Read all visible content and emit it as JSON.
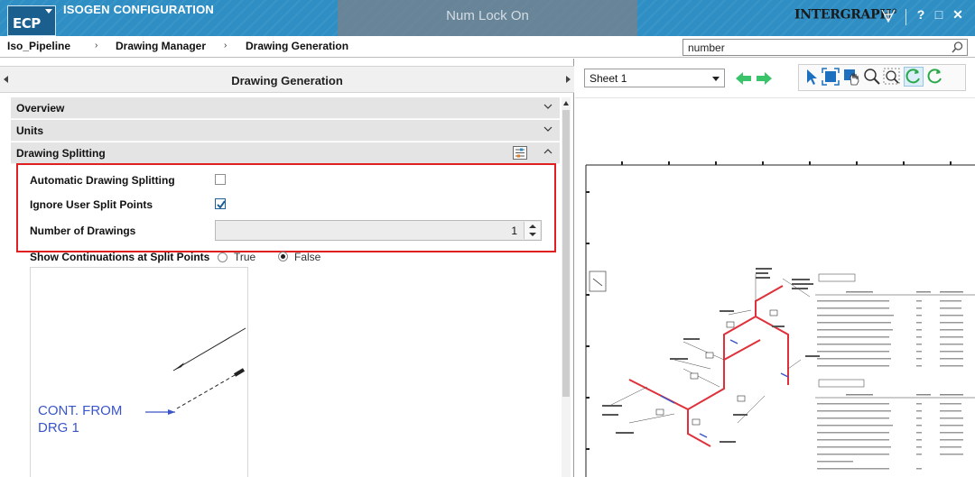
{
  "app": {
    "logo": "ECP",
    "title": "ISOGEN CONFIGURATION",
    "toast": "Num Lock On",
    "brand": "INTERGRAPH",
    "brand_mark": "®",
    "window_controls": {
      "help": "?",
      "restore": "□",
      "close": "✕"
    }
  },
  "breadcrumb": {
    "items": [
      "Iso_Pipeline",
      "Drawing Manager",
      "Drawing Generation"
    ],
    "separator": "›"
  },
  "search": {
    "value": "number",
    "icon": "search-icon"
  },
  "left_panel": {
    "title": "Drawing Generation",
    "sections": [
      {
        "label": "Overview",
        "expanded": false
      },
      {
        "label": "Units",
        "expanded": false
      },
      {
        "label": "Drawing Splitting",
        "expanded": true
      }
    ],
    "properties": {
      "automatic_splitting": {
        "label": "Automatic Drawing Splitting",
        "checked": false
      },
      "ignore_user_split": {
        "label": "Ignore User Split Points",
        "checked": true
      },
      "number_of_drawings": {
        "label": "Number of Drawings",
        "value": "1"
      },
      "show_continuations": {
        "label": "Show Continuations at Split Points",
        "options": [
          "True",
          "False"
        ],
        "selected": "False"
      }
    },
    "preview": {
      "text_line1": "CONT. FROM",
      "text_line2": "DRG 1"
    }
  },
  "right_panel": {
    "sheet_select": {
      "value": "Sheet 1"
    },
    "toolbar_icons": [
      "back-arrow-icon",
      "forward-arrow-icon",
      "select-pointer-icon",
      "fit-view-icon",
      "pan-hand-icon",
      "zoom-icon",
      "zoom-window-icon",
      "refresh-icon",
      "redo-icon"
    ]
  },
  "colors": {
    "titlebar": "#2f8fc4",
    "highlight_border": "#e02020",
    "checkbox_check": "#1d5f96",
    "nav_arrow": "#39c46a",
    "preview_text": "#3a55c8"
  }
}
